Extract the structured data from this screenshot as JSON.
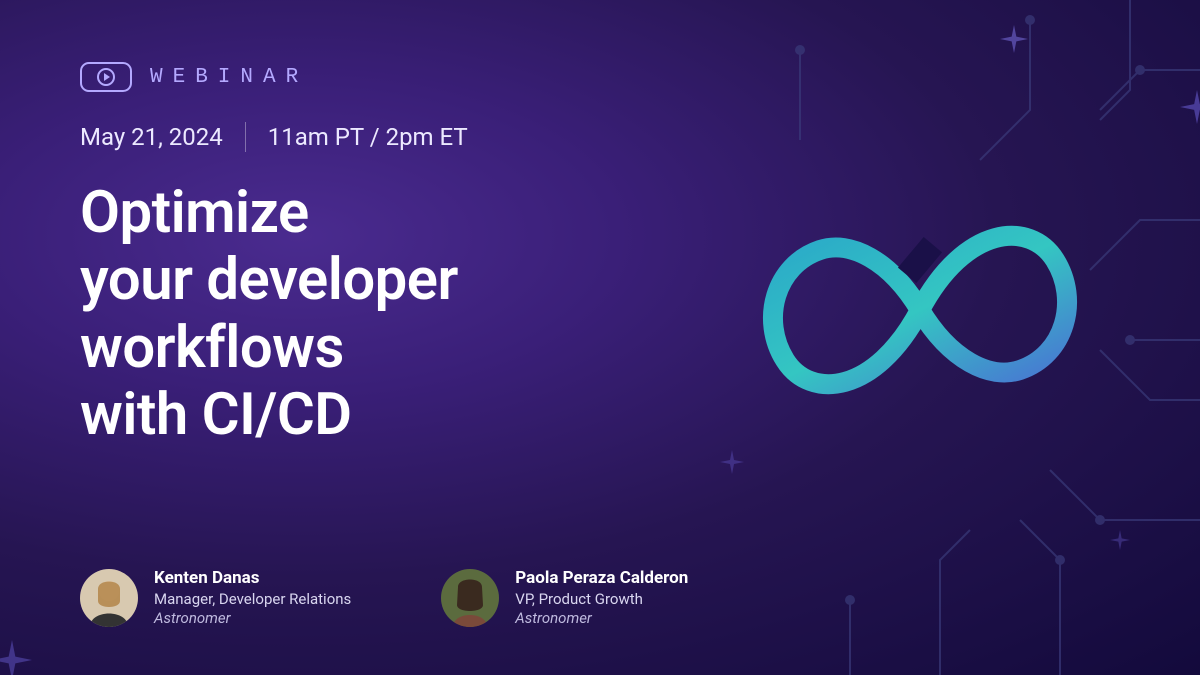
{
  "badge": {
    "label": "WEBINAR"
  },
  "meta": {
    "date": "May 21, 2024",
    "time": "11am PT / 2pm ET"
  },
  "title": "Optimize\nyour developer\nworkflows\nwith CI/CD",
  "speakers": [
    {
      "name": "Kenten Danas",
      "role": "Manager, Developer Relations",
      "company": "Astronomer",
      "avatar_bg": "#d8c9b0"
    },
    {
      "name": "Paola Peraza Calderon",
      "role": "VP, Product Growth",
      "company": "Astronomer",
      "avatar_bg": "#5b6b3e"
    }
  ],
  "colors": {
    "accent": "#b4a9ff",
    "infinity_stroke": "#34c6c2",
    "circuit": "#3a3480"
  }
}
